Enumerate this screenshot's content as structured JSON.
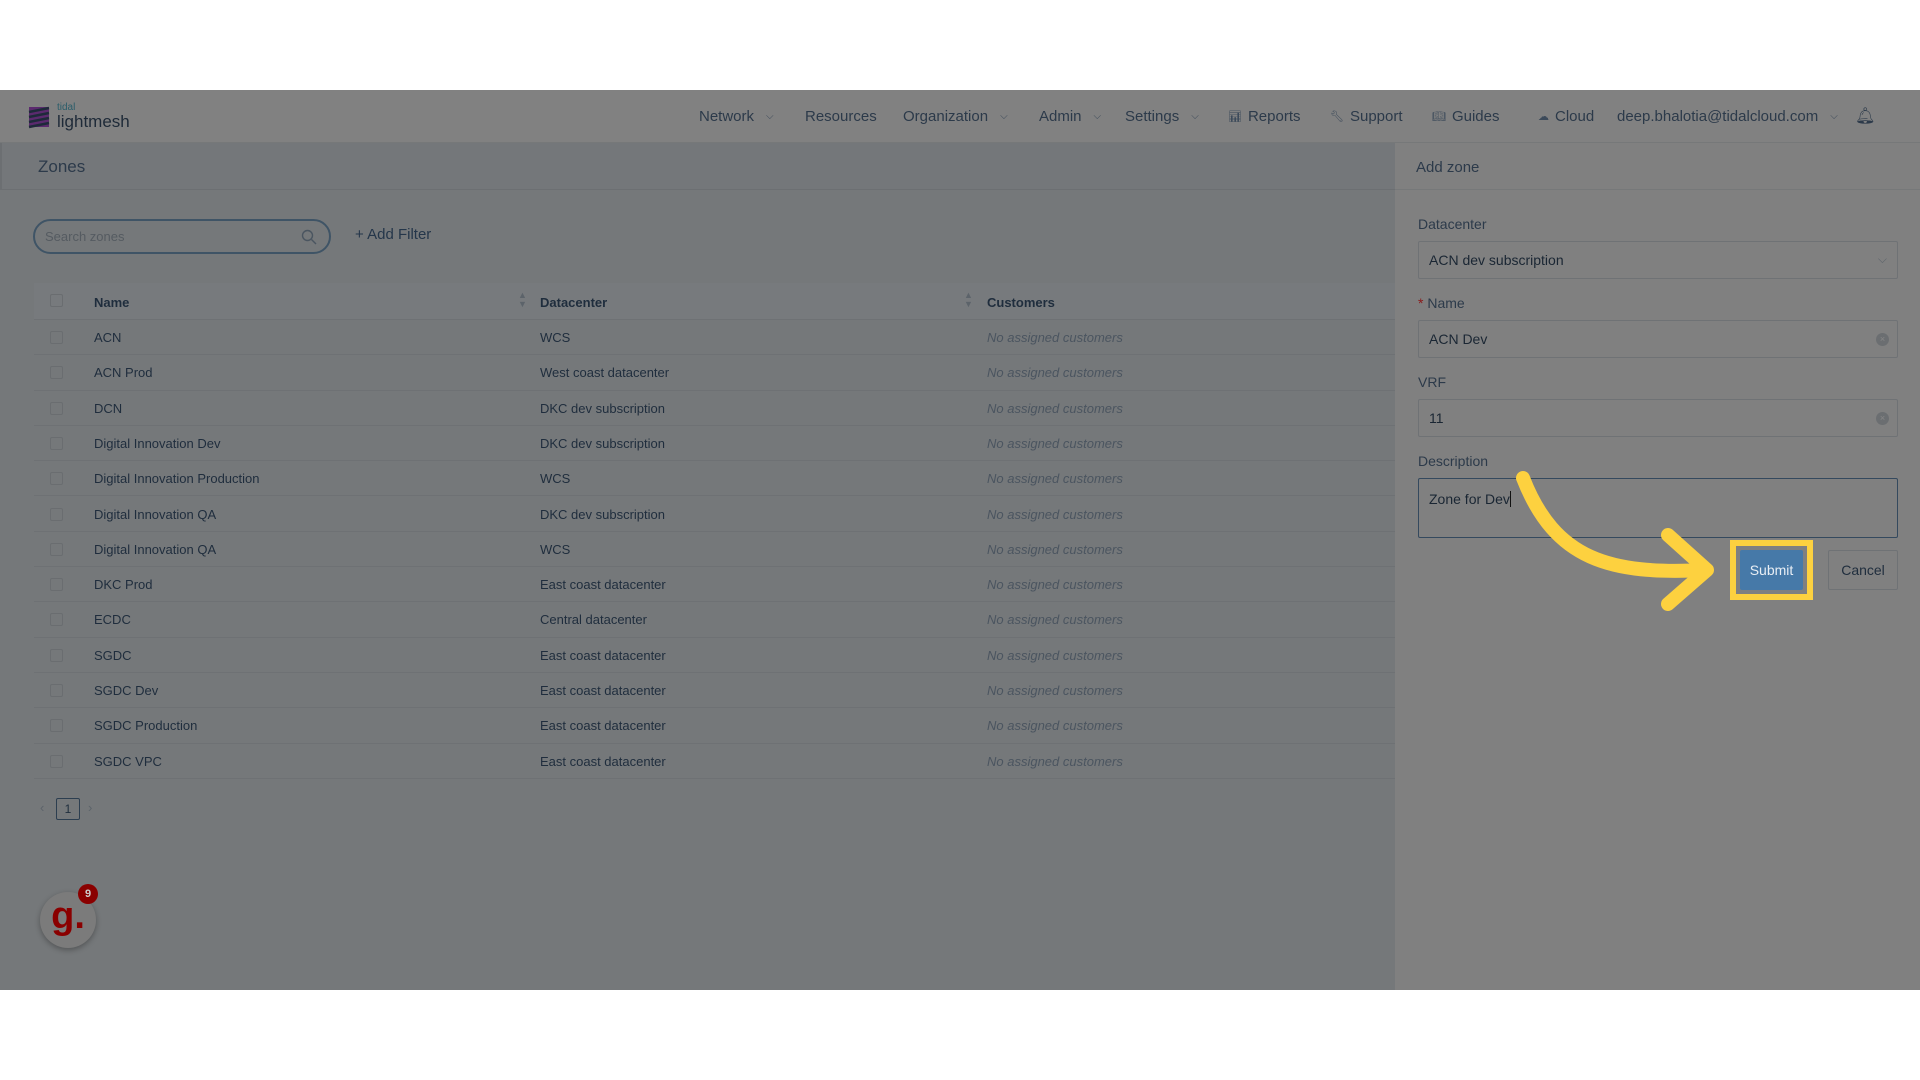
{
  "brand": {
    "top": "tidal",
    "name": "lightmesh"
  },
  "nav": [
    {
      "label": "Network",
      "dropdown": true,
      "icon": ""
    },
    {
      "label": "Resources",
      "dropdown": false,
      "icon": ""
    },
    {
      "label": "Organization",
      "dropdown": true,
      "icon": ""
    },
    {
      "label": "Admin",
      "dropdown": true,
      "icon": ""
    },
    {
      "label": "Settings",
      "dropdown": true,
      "icon": ""
    },
    {
      "label": "Reports",
      "dropdown": false,
      "icon": "bar-chart-icon"
    },
    {
      "label": "Support",
      "dropdown": false,
      "icon": "wrench-icon"
    },
    {
      "label": "Guides",
      "dropdown": false,
      "icon": "book-icon"
    },
    {
      "label": "Cloud",
      "dropdown": false,
      "icon": "cloud-icon"
    },
    {
      "label": "deep.bhalotia@tidalcloud.com",
      "dropdown": true,
      "icon": ""
    }
  ],
  "page": {
    "title": "Zones",
    "search_placeholder": "Search zones",
    "add_filter": "Add Filter"
  },
  "table": {
    "columns": [
      "Name",
      "Datacenter",
      "Customers"
    ],
    "rows": [
      [
        "ACN",
        "WCS",
        "No assigned customers"
      ],
      [
        "ACN Prod",
        "West coast datacenter",
        "No assigned customers"
      ],
      [
        "DCN",
        "DKC dev subscription",
        "No assigned customers"
      ],
      [
        "Digital Innovation Dev",
        "DKC dev subscription",
        "No assigned customers"
      ],
      [
        "Digital Innovation Production",
        "WCS",
        "No assigned customers"
      ],
      [
        "Digital Innovation QA",
        "DKC dev subscription",
        "No assigned customers"
      ],
      [
        "Digital Innovation QA",
        "WCS",
        "No assigned customers"
      ],
      [
        "DKC Prod",
        "East coast datacenter",
        "No assigned customers"
      ],
      [
        "ECDC",
        "Central datacenter",
        "No assigned customers"
      ],
      [
        "SGDC",
        "East coast datacenter",
        "No assigned customers"
      ],
      [
        "SGDC Dev",
        "East coast datacenter",
        "No assigned customers"
      ],
      [
        "SGDC Production",
        "East coast datacenter",
        "No assigned customers"
      ],
      [
        "SGDC VPC",
        "East coast datacenter",
        "No assigned customers"
      ]
    ]
  },
  "pagination": {
    "current": "1"
  },
  "chat": {
    "letter": "g.",
    "badge": "9"
  },
  "panel": {
    "title": "Add zone",
    "datacenter_label": "Datacenter",
    "datacenter_value": "ACN dev subscription",
    "name_label": "Name",
    "name_required": "*",
    "name_value": "ACN Dev",
    "vrf_label": "VRF",
    "vrf_value": "11",
    "description_label": "Description",
    "description_value": "Zone for Dev",
    "submit": "Submit",
    "cancel": "Cancel"
  },
  "colors": {
    "highlight": "#fdd13f",
    "submit": "#4679a8",
    "accent": "#2c3a4a"
  }
}
